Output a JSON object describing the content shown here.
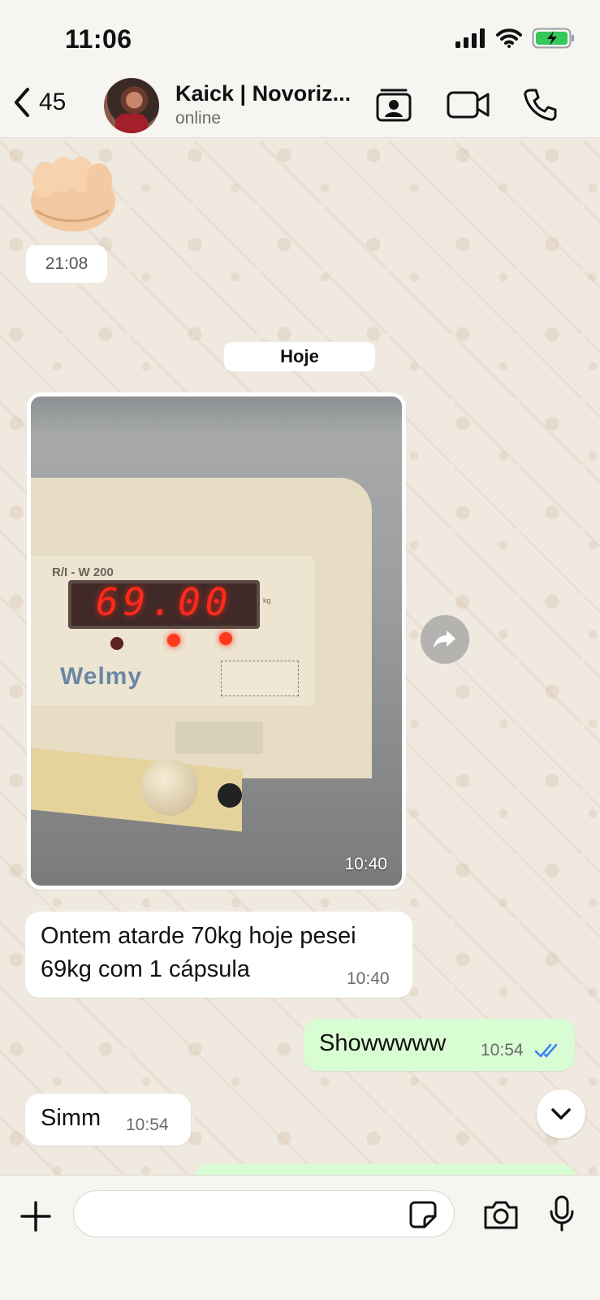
{
  "status_bar": {
    "time": "11:06"
  },
  "header": {
    "back_count": "45",
    "contact_name": "Kaick | Novoriz...",
    "contact_status": "online"
  },
  "chat": {
    "prev_time": "21:08",
    "date_separator": "Hoje",
    "image_message": {
      "time": "10:40",
      "scale_reading": "69.00",
      "scale_model": "R/I - W 200",
      "brand": "Welmy"
    },
    "messages": [
      {
        "direction": "in",
        "text_line1": "Ontem atarde 70kg hoje pesei",
        "text_line2": "69kg com 1 cápsula",
        "time": "10:40"
      },
      {
        "direction": "out",
        "text": "Showwwww",
        "time": "10:54",
        "status": "read"
      },
      {
        "direction": "in",
        "text": "Simm",
        "time": "10:54"
      }
    ]
  },
  "composer": {
    "placeholder": ""
  },
  "colors": {
    "outgoing_bubble": "#d9fdd3",
    "read_ticks": "#3b82f6",
    "battery": "#34c759"
  }
}
